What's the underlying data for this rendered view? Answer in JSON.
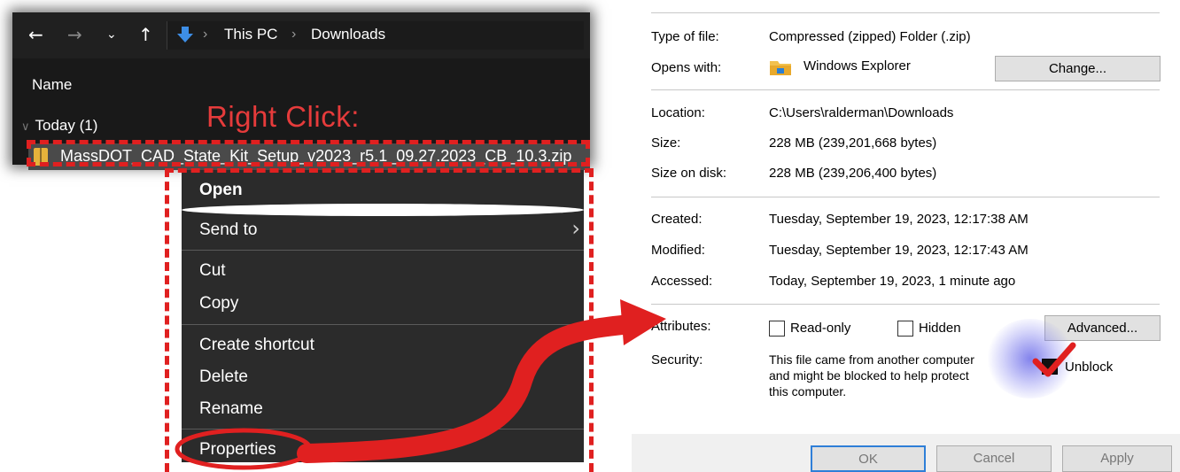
{
  "explorer": {
    "breadcrumb": [
      "This PC",
      "Downloads"
    ],
    "column_header": "Name",
    "group_label": "Today (1)",
    "file_name": "MassDOT_CAD_State_Kit_Setup_v2023_r5.1_09.27.2023_CB_10.3.zip",
    "annotation": "Right Click:"
  },
  "context_menu": {
    "items": [
      "Open",
      "Send to",
      "Cut",
      "Copy",
      "Create shortcut",
      "Delete",
      "Rename",
      "Properties"
    ]
  },
  "properties": {
    "type_label": "Type of file:",
    "type_value": "Compressed (zipped) Folder (.zip)",
    "opens_label": "Opens with:",
    "opens_value": "Windows Explorer",
    "change_button": "Change...",
    "location_label": "Location:",
    "location_value": "C:\\Users\\ralderman\\Downloads",
    "size_label": "Size:",
    "size_value": "228 MB (239,201,668 bytes)",
    "size_disk_label": "Size on disk:",
    "size_disk_value": "228 MB (239,206,400 bytes)",
    "created_label": "Created:",
    "created_value": "Tuesday, September 19, 2023, 12:17:38 AM",
    "modified_label": "Modified:",
    "modified_value": "Tuesday, September 19, 2023, 12:17:43 AM",
    "accessed_label": "Accessed:",
    "accessed_value": "Today, September 19, 2023, 1 minute ago",
    "attributes_label": "Attributes:",
    "readonly_label": "Read-only",
    "readonly_checked": false,
    "hidden_label": "Hidden",
    "hidden_checked": false,
    "advanced_button": "Advanced...",
    "security_label": "Security:",
    "security_text_1": "This file came from another computer",
    "security_text_2": "and might be blocked to help protect",
    "security_text_3": "this computer.",
    "unblock_label": "Unblock",
    "unblock_checked": true,
    "ok_button": "OK",
    "cancel_button": "Cancel",
    "apply_button": "Apply"
  },
  "colors": {
    "annotation_red": "#e02020",
    "explorer_bg": "#191919",
    "menu_bg": "#2b2b2b"
  }
}
